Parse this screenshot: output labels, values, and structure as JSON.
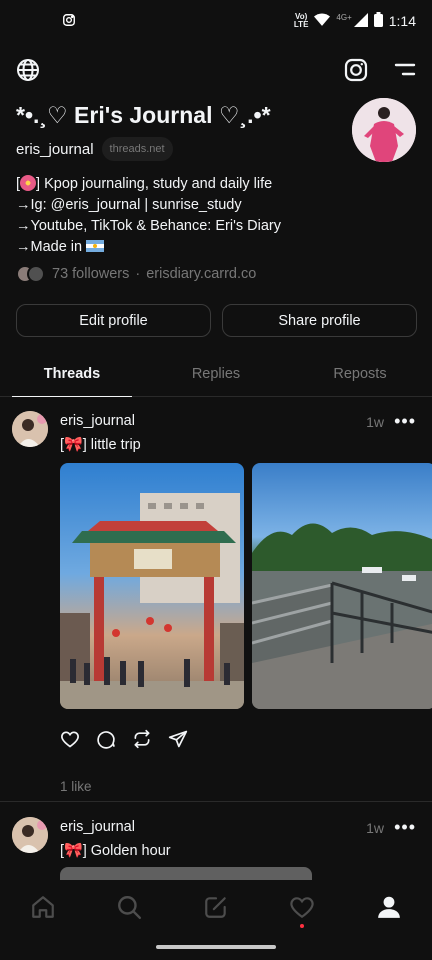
{
  "status_bar": {
    "time": "1:14",
    "volte": "Vo\nLTE",
    "network": "4G+"
  },
  "profile": {
    "display_name": "*•.¸♡ Eri's Journal ♡¸.•*",
    "handle": "eris_journal",
    "domain_badge": "threads.net",
    "bio": {
      "line1_prefix": "[",
      "line1_suffix": "] Kpop journaling, study and daily life",
      "line2": "→Ig: @eris_journal | sunrise_study",
      "line3": "→Youtube, TikTok & Behance: Eri's Diary",
      "line4": "→Made in "
    },
    "followers": "73 followers",
    "separator": "·",
    "link": "erisdiary.carrd.co"
  },
  "buttons": {
    "edit": "Edit profile",
    "share": "Share profile"
  },
  "tabs": [
    {
      "label": "Threads"
    },
    {
      "label": "Replies"
    },
    {
      "label": "Reposts"
    }
  ],
  "posts": [
    {
      "user": "eris_journal",
      "time": "1w",
      "more": "•••",
      "text_prefix": "[",
      "text_suffix": "] little trip",
      "likes": "1 like"
    },
    {
      "user": "eris_journal",
      "time": "1w",
      "more": "•••",
      "text_prefix": "[",
      "text_suffix": "] Golden hour"
    }
  ],
  "icons": {
    "status": [
      "instagram-notification-icon",
      "wifi-icon",
      "signal-icon",
      "battery-icon"
    ],
    "top_bar": [
      "globe-icon",
      "instagram-icon",
      "menu-icon"
    ],
    "post_actions": [
      "heart-icon",
      "comment-icon",
      "repost-icon",
      "share-icon"
    ],
    "nav": [
      "home-icon",
      "search-icon",
      "compose-icon",
      "activity-icon",
      "profile-icon"
    ]
  },
  "colors": {
    "background": "#101010",
    "text": "#f3f5f7",
    "muted": "#777777",
    "notification": "#ff3040"
  }
}
